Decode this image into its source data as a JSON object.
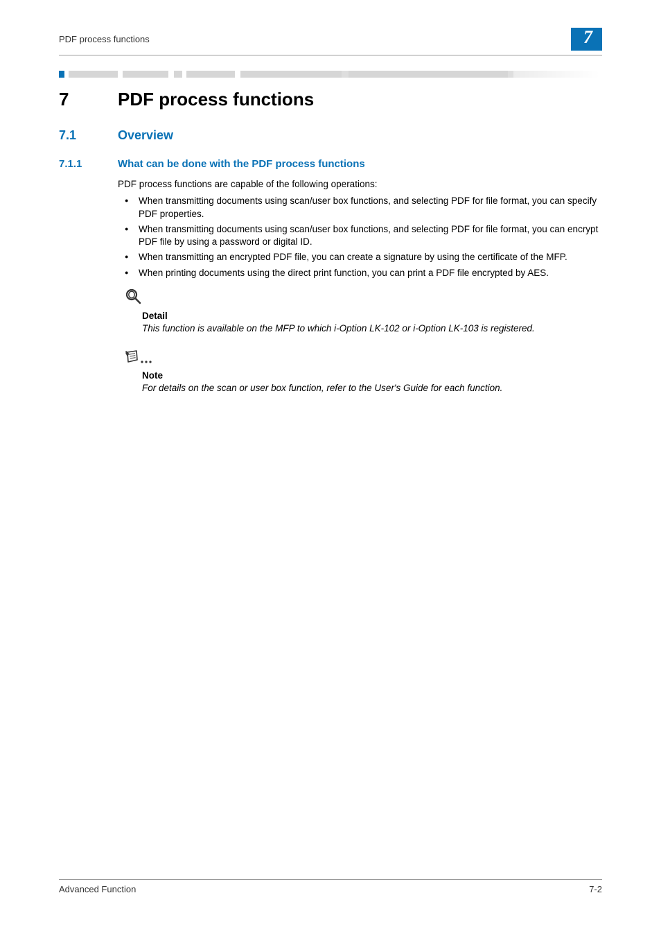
{
  "header": {
    "running_title": "PDF process functions",
    "chapter_badge": "7"
  },
  "chapter": {
    "number": "7",
    "title": "PDF process functions"
  },
  "section": {
    "number": "7.1",
    "title": "Overview"
  },
  "subsection": {
    "number": "7.1.1",
    "title": "What can be done with the PDF process functions"
  },
  "intro": "PDF process functions are capable of the following operations:",
  "bullets": [
    "When transmitting documents using scan/user box functions, and selecting PDF for file format, you can specify PDF properties.",
    "When transmitting documents using scan/user box functions, and selecting PDF for file format, you can encrypt PDF file by using a password or digital ID.",
    "When transmitting an encrypted PDF file, you can create a signature by using the certificate of the MFP.",
    "When printing documents using the direct print function, you can print a PDF file encrypted by AES."
  ],
  "detail": {
    "header": "Detail",
    "body": "This function is available on the MFP to which i-Option LK-102 or i-Option LK-103 is registered."
  },
  "note": {
    "header": "Note",
    "body": "For details on the scan or user box function, refer to the User's Guide for each function."
  },
  "footer": {
    "left": "Advanced Function",
    "right": "7-2"
  }
}
